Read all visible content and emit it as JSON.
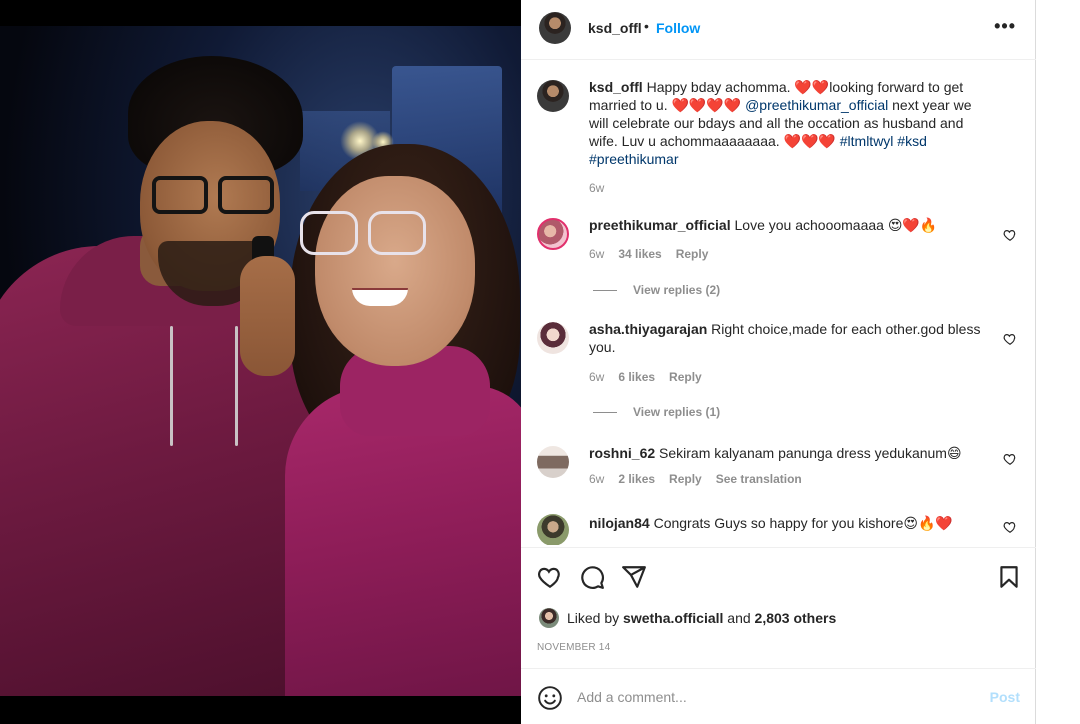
{
  "header": {
    "username": "ksd_offl",
    "separator": "•",
    "follow_label": "Follow",
    "more_label": "•••"
  },
  "caption": {
    "username": "ksd_offl",
    "text_1": "Happy bday achomma. ❤️❤️looking forward to get married to u. ❤️❤️❤️❤️",
    "mention": "@preethikumar_official",
    "text_2": " next year we will celebrate our bdays and all the occation as husband and wife. Luv u achommaaaaaaaa. ❤️❤️❤️ ",
    "hashtags": "#ltmltwyl #ksd #preethikumar",
    "time": "6w"
  },
  "comments": [
    {
      "username": "preethikumar_official",
      "text": "Love you achooomaaaa 😍❤️🔥",
      "time": "6w",
      "likes": "34 likes",
      "reply_label": "Reply",
      "view_replies": "View replies (2)"
    },
    {
      "username": "asha.thiyagarajan",
      "text": "Right choice,made for each other.god bless you.",
      "time": "6w",
      "likes": "6 likes",
      "reply_label": "Reply",
      "view_replies": "View replies (1)"
    },
    {
      "username": "roshni_62",
      "text": "Sekiram kalyanam panunga dress yedukanum😄",
      "time": "6w",
      "likes": "2 likes",
      "reply_label": "Reply",
      "translation_label": "See translation"
    },
    {
      "username": "nilojan84",
      "text": "Congrats Guys so happy for you kishore😍🔥❤️"
    }
  ],
  "actions": {
    "icons": [
      "heart-icon",
      "comment-icon",
      "share-icon",
      "bookmark-icon"
    ],
    "liked_prefix": "Liked by",
    "liked_user": "swetha.officiall",
    "liked_middle": "and",
    "liked_count": "2,803 others",
    "date": "NOVEMBER 14"
  },
  "add_comment": {
    "placeholder": "Add a comment...",
    "post_label": "Post"
  },
  "colors": {
    "accent": "#0095f6",
    "post_disabled": "#b2dffc",
    "muted": "#8e8e8e",
    "text": "#262626",
    "link": "#00376b"
  }
}
